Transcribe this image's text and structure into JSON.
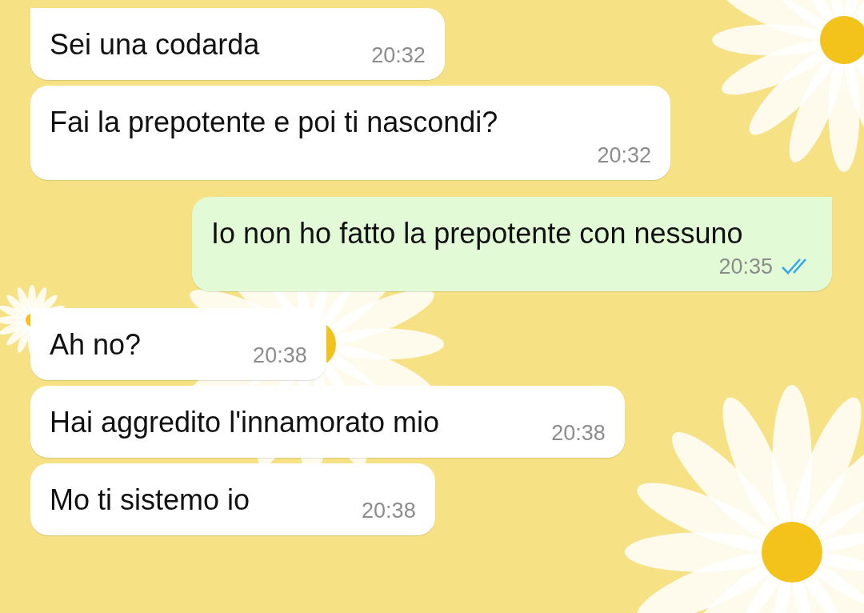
{
  "messages": [
    {
      "outgoing": false,
      "first_in_group": true,
      "text": "Sei una codarda",
      "time": "20:32"
    },
    {
      "outgoing": false,
      "first_in_group": false,
      "text": "Fai la prepotente e poi ti nascondi?",
      "time": "20:32"
    },
    {
      "outgoing": true,
      "first_in_group": true,
      "text": "Io non ho fatto la prepotente con nessuno",
      "time": "20:35",
      "read": true
    },
    {
      "outgoing": false,
      "first_in_group": true,
      "text": "Ah no?",
      "time": "20:38"
    },
    {
      "outgoing": false,
      "first_in_group": false,
      "text": "Hai aggredito l'innamorato mio",
      "time": "20:38"
    },
    {
      "outgoing": false,
      "first_in_group": false,
      "text": "Mo ti sistemo io",
      "time": "20:38"
    }
  ]
}
